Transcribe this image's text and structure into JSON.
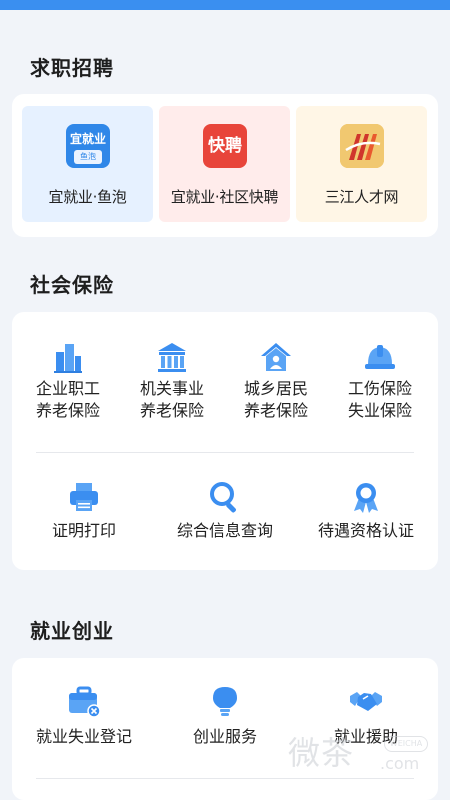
{
  "sections": {
    "jobs": {
      "title": "求职招聘"
    },
    "insurance": {
      "title": "社会保险"
    },
    "employment": {
      "title": "就业创业"
    }
  },
  "job_tiles": [
    {
      "label": "宜就业·鱼泡",
      "logo_text": "宜就业",
      "logo_sub": "鱼泡",
      "bg": "#e6f1ff"
    },
    {
      "label": "宜就业·社区快聘",
      "logo_text": "快聘",
      "bg": "#ffeceb"
    },
    {
      "label": "三江人才网",
      "bg": "#fff6e6"
    }
  ],
  "insurance_items": [
    {
      "line1": "企业职工",
      "line2": "养老保险",
      "icon": "building-icon"
    },
    {
      "line1": "机关事业",
      "line2": "养老保险",
      "icon": "institution-icon"
    },
    {
      "line1": "城乡居民",
      "line2": "养老保险",
      "icon": "house-icon"
    },
    {
      "line1": "工伤保险",
      "line2": "失业保险",
      "icon": "hardhat-icon"
    },
    {
      "label": "证明打印",
      "icon": "printer-icon"
    },
    {
      "label": "综合信息查询",
      "icon": "magnifier-icon"
    },
    {
      "label": "待遇资格认证",
      "icon": "medal-icon"
    }
  ],
  "employment_items": [
    {
      "label": "就业失业登记",
      "icon": "briefcase-icon"
    },
    {
      "label": "创业服务",
      "icon": "lightbulb-icon"
    },
    {
      "label": "就业援助",
      "icon": "handshake-icon"
    }
  ],
  "watermark": {
    "text": "微茶",
    "badge": "WEICHA",
    "domain": ".com"
  },
  "colors": {
    "accent": "#3a8ff0",
    "icon_blue": "#3b8ef0",
    "page_bg": "#f1f4f9"
  }
}
